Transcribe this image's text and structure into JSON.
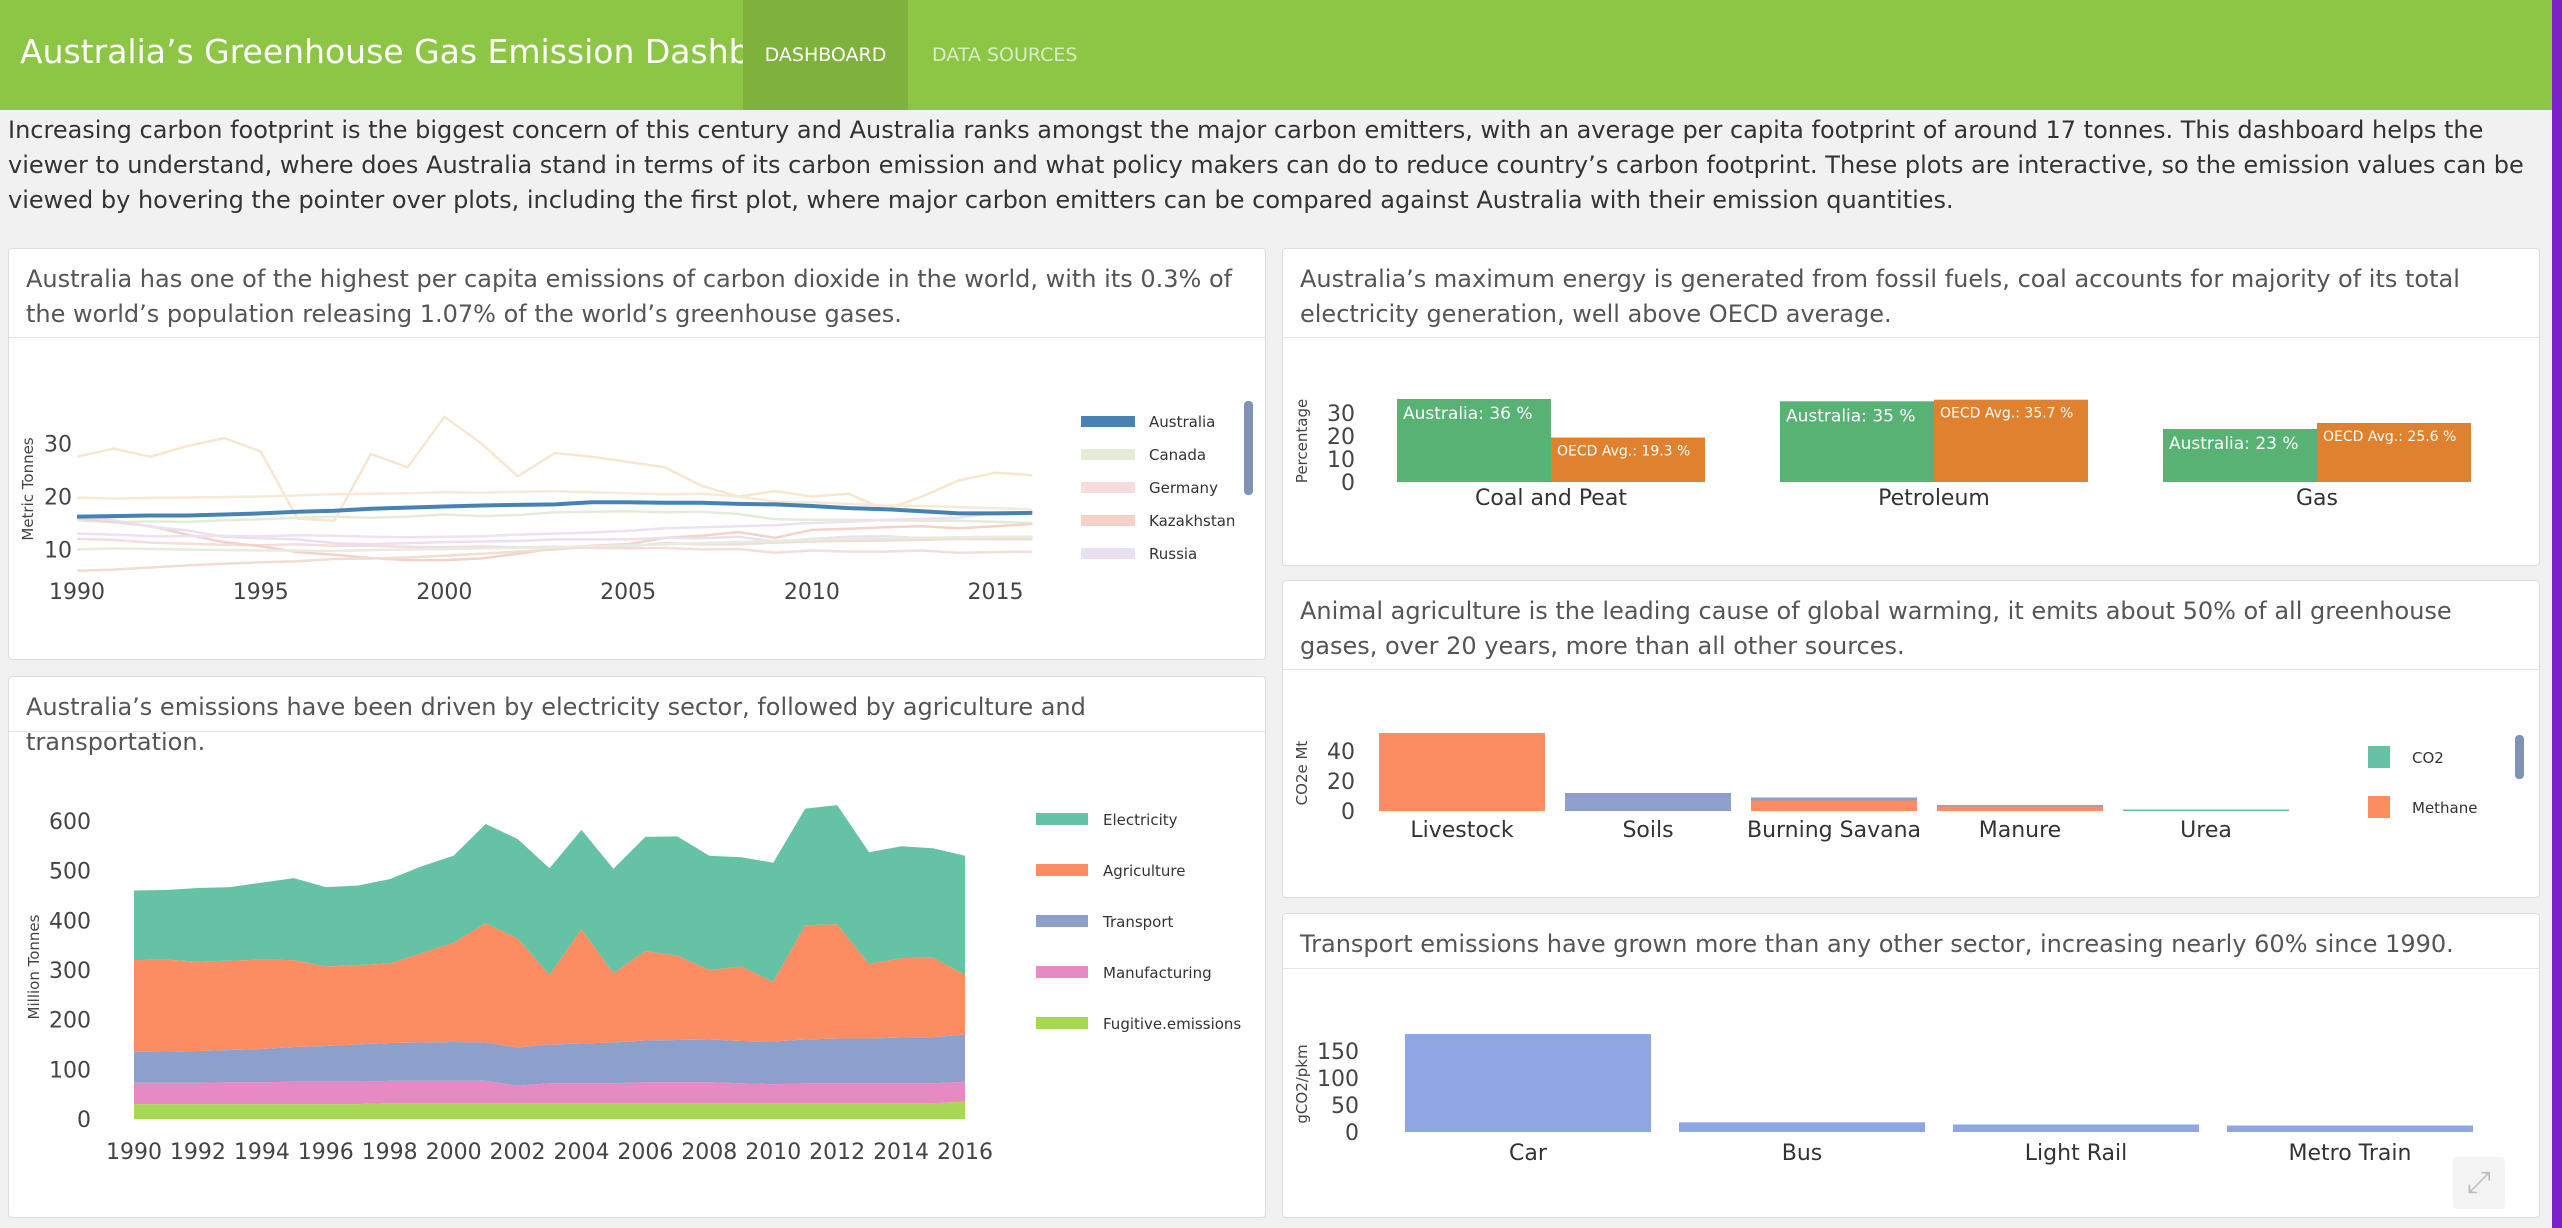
{
  "header": {
    "title": "Australia’s Greenhouse Gas Emission Dashboard",
    "tabs": [
      {
        "label": "DASHBOARD",
        "active": true
      },
      {
        "label": "DATA SOURCES",
        "active": false
      }
    ]
  },
  "intro": "Increasing carbon footprint is the biggest concern of this century and Australia ranks amongst the major carbon emitters, with an average per capita footprint of around 17 tonnes. This dashboard helps the viewer to understand, where does Australia stand in terms of its carbon emission and what policy makers can do to reduce country’s carbon footprint. These plots are interactive, so the emission values can be viewed by hovering the pointer over plots, including the first plot, where major carbon emitters can be compared against Australia with their emission quantities.",
  "panels": {
    "per_capita": {
      "title": "Australia has one of the highest per capita emissions of carbon dioxide in the world, with its 0.3% of the world’s population releasing 1.07% of the world’s greenhouse gases."
    },
    "sectors": {
      "title": "Australia’s emissions have been driven by electricity sector, followed by agriculture and transportation."
    },
    "energy": {
      "title": "Australia’s maximum energy is generated from fossil fuels, coal accounts for majority of its total electricity generation, well above OECD average."
    },
    "agriculture": {
      "title": "Animal agriculture is the leading cause of global warming, it emits about 50% of all greenhouse gases, over 20 years, more than all other sources."
    },
    "transport": {
      "title": "Transport emissions have grown more than any other sector, increasing nearly 60% since 1990."
    }
  },
  "icons": {
    "expand": "expand-arrows-icon"
  },
  "colors": {
    "navbar": "#8dc545",
    "navbar_active": "#7fb23c",
    "australia_line": "#4682b4"
  },
  "chart_data": [
    {
      "type": "line",
      "ylabel": "Metric Tonnes",
      "ylim": [
        5,
        38
      ],
      "yticks": [
        10,
        20,
        30
      ],
      "xticks": [
        1990,
        1995,
        2000,
        2005,
        2010,
        2015
      ],
      "x": [
        1990,
        1991,
        1992,
        1993,
        1994,
        1995,
        1996,
        1997,
        1998,
        1999,
        2000,
        2001,
        2002,
        2003,
        2004,
        2005,
        2006,
        2007,
        2008,
        2009,
        2010,
        2011,
        2012,
        2013,
        2014,
        2015,
        2016
      ],
      "series": [
        {
          "name": "Australia",
          "color": "#4682b4",
          "highlight": true,
          "values": [
            16.2,
            16.3,
            16.4,
            16.4,
            16.6,
            16.8,
            17.1,
            17.3,
            17.7,
            17.9,
            18.1,
            18.3,
            18.4,
            18.5,
            18.9,
            18.9,
            18.8,
            18.8,
            18.6,
            18.5,
            18.2,
            17.8,
            17.6,
            17.2,
            16.8,
            16.8,
            16.9
          ]
        },
        {
          "name": "Canada",
          "color": "#e4ecd9",
          "values": [
            15.5,
            15.1,
            15.3,
            15.2,
            15.5,
            15.7,
            16.0,
            16.2,
            16.0,
            16.2,
            16.6,
            16.3,
            16.5,
            17.0,
            17.1,
            17.2,
            17.0,
            17.1,
            16.7,
            15.7,
            15.6,
            15.6,
            15.5,
            15.4,
            15.4,
            15.2,
            15.0
          ]
        },
        {
          "name": "Germany",
          "color": "#f6dcdc",
          "values": [
            12.0,
            11.8,
            11.3,
            11.1,
            10.9,
            10.8,
            11.0,
            10.7,
            10.7,
            10.5,
            10.4,
            10.6,
            10.4,
            10.5,
            10.3,
            10.2,
            10.3,
            10.0,
            10.1,
            9.4,
            9.8,
            9.6,
            9.6,
            9.8,
            9.4,
            9.5,
            9.6
          ]
        },
        {
          "name": "Kazakhstan",
          "color": "#f5d2c8",
          "values": [
            15.9,
            15.2,
            14.4,
            12.8,
            11.4,
            10.6,
            9.5,
            9.0,
            8.4,
            8.0,
            8.0,
            8.3,
            9.2,
            10.2,
            10.7,
            11.0,
            12.2,
            12.6,
            13.3,
            12.2,
            13.7,
            13.9,
            14.2,
            14.4,
            14.0,
            14.4,
            14.8
          ]
        },
        {
          "name": "Russia",
          "color": "#e9e1ef",
          "values": [
            16.2,
            15.5,
            14.3,
            13.6,
            12.4,
            12.1,
            11.9,
            11.2,
            11.0,
            11.2,
            11.4,
            11.5,
            11.6,
            11.9,
            11.9,
            11.9,
            12.2,
            12.1,
            12.4,
            11.5,
            12.0,
            12.4,
            12.5,
            12.1,
            12.0,
            11.9,
            11.9
          ]
        },
        {
          "name": "",
          "color": "#f8e6cf",
          "values": [
            27.5,
            29.0,
            27.5,
            29.5,
            31.0,
            28.5,
            15.8,
            15.4,
            28.0,
            25.5,
            35.0,
            30.0,
            23.8,
            28.2,
            27.5,
            26.5,
            25.5,
            22.0,
            20.0,
            21.0,
            20.0,
            20.5,
            17.5,
            20.0,
            23.0,
            24.5,
            24.0
          ]
        },
        {
          "name": "",
          "color": "#f7ead4",
          "values": [
            19.8,
            19.6,
            19.7,
            19.8,
            19.9,
            20.0,
            20.2,
            20.4,
            20.5,
            20.6,
            20.8,
            20.7,
            20.9,
            21.0,
            20.8,
            20.6,
            20.4,
            20.5,
            20.0,
            19.0,
            18.9,
            18.6,
            18.3,
            18.2,
            18.0,
            17.8,
            17.6
          ]
        },
        {
          "name": "",
          "color": "#eee1f2",
          "values": [
            13.0,
            12.8,
            12.5,
            12.5,
            12.6,
            12.5,
            12.7,
            12.6,
            12.4,
            12.3,
            12.4,
            12.5,
            12.8,
            13.0,
            13.2,
            13.5,
            14.0,
            14.2,
            14.4,
            14.6,
            15.0,
            15.2,
            15.6,
            15.8,
            16.0,
            17.0,
            17.0
          ]
        },
        {
          "name": "",
          "color": "#f1ddd1",
          "values": [
            6.0,
            6.2,
            6.6,
            7.0,
            7.3,
            7.6,
            7.8,
            8.2,
            8.3,
            8.5,
            8.8,
            9.2,
            9.6,
            10.0,
            10.5,
            10.6,
            11.2,
            11.0,
            11.0,
            11.3,
            11.5,
            11.6,
            11.7,
            11.8,
            12.0,
            12.0,
            12.0
          ]
        },
        {
          "name": "",
          "color": "#e6ecdf",
          "values": [
            10.0,
            10.2,
            10.1,
            10.0,
            9.9,
            9.8,
            9.8,
            9.7,
            9.9,
            10.0,
            10.1,
            10.2,
            10.3,
            10.4,
            10.6,
            10.8,
            11.0,
            11.2,
            11.4,
            11.6,
            11.8,
            12.0,
            12.1,
            12.2,
            12.3,
            12.4,
            12.4
          ]
        }
      ]
    },
    {
      "type": "area",
      "ylabel": "Million Tonnes",
      "ylim": [
        0,
        650
      ],
      "yticks": [
        0,
        100,
        200,
        300,
        400,
        500,
        600
      ],
      "x": [
        1990,
        1991,
        1992,
        1993,
        1994,
        1995,
        1996,
        1997,
        1998,
        1999,
        2000,
        2001,
        2002,
        2003,
        2004,
        2005,
        2006,
        2007,
        2008,
        2009,
        2010,
        2011,
        2012,
        2013,
        2014,
        2015,
        2016
      ],
      "xticks": [
        1990,
        1992,
        1994,
        1996,
        1998,
        2000,
        2002,
        2004,
        2006,
        2008,
        2010,
        2012,
        2014,
        2016
      ],
      "series": [
        {
          "name": "Fugitive.emissions",
          "color": "#a6d854",
          "values": [
            30,
            30,
            30,
            30,
            30,
            30,
            30,
            30,
            32,
            32,
            32,
            32,
            32,
            32,
            32,
            32,
            32,
            32,
            32,
            32,
            32,
            32,
            32,
            32,
            32,
            32,
            35
          ]
        },
        {
          "name": "Manufacturing",
          "color": "#e78ac3",
          "values": [
            43,
            43,
            43,
            44,
            44,
            45,
            45,
            45,
            45,
            45,
            45,
            45,
            35,
            40,
            40,
            40,
            42,
            42,
            42,
            40,
            38,
            40,
            40,
            40,
            40,
            40,
            40
          ]
        },
        {
          "name": "Transport",
          "color": "#8da0cb",
          "values": [
            62,
            63,
            64,
            65,
            67,
            70,
            72,
            75,
            76,
            77,
            78,
            77,
            77,
            78,
            80,
            82,
            84,
            85,
            86,
            85,
            86,
            88,
            90,
            90,
            92,
            93,
            95
          ]
        },
        {
          "name": "Agriculture",
          "color": "#fc8d62",
          "values": [
            185,
            185,
            180,
            180,
            180,
            175,
            160,
            160,
            160,
            180,
            200,
            240,
            220,
            140,
            230,
            140,
            180,
            170,
            140,
            150,
            120,
            230,
            230,
            150,
            160,
            160,
            120
          ]
        },
        {
          "name": "Electricity",
          "color": "#66c2a5",
          "values": [
            140,
            140,
            148,
            148,
            155,
            165,
            160,
            160,
            170,
            175,
            175,
            200,
            200,
            215,
            200,
            210,
            230,
            240,
            230,
            220,
            240,
            235,
            240,
            225,
            225,
            220,
            240
          ]
        }
      ],
      "legend_order": [
        "Electricity",
        "Agriculture",
        "Transport",
        "Manufacturing",
        "Fugitive.emissions"
      ]
    },
    {
      "type": "bar",
      "ylabel": "Percentage",
      "ylim": [
        0,
        36
      ],
      "yticks": [
        0,
        10,
        20,
        30
      ],
      "categories": [
        "Coal and Peat",
        "Petroleum",
        "Gas"
      ],
      "series": [
        {
          "name": "Australia",
          "color": "#57b274",
          "values": [
            36,
            35,
            23
          ]
        },
        {
          "name": "OECD Avg.",
          "color": "#e0812f",
          "values": [
            19.3,
            35.7,
            25.6
          ]
        }
      ],
      "data_labels": [
        [
          "Australia:  36 %",
          "Australia:  35 %",
          "Australia:  23 %"
        ],
        [
          "OECD Avg.: 19.3 %",
          "OECD Avg.: 35.7 %",
          "OECD Avg.: 25.6 %"
        ]
      ]
    },
    {
      "type": "bar",
      "ylabel": "CO2e Mt",
      "ylim": [
        0,
        55
      ],
      "yticks": [
        0,
        20,
        40
      ],
      "categories": [
        "Livestock",
        "Soils",
        "Burning Savana",
        "Manure",
        "Urea"
      ],
      "series": [
        {
          "name": "Methane",
          "color": "#fc8d62",
          "values": [
            52,
            0,
            7,
            3,
            0
          ]
        },
        {
          "name": "CO2",
          "color": "#66c2a5",
          "values": [
            0,
            0,
            0,
            0,
            1
          ]
        },
        {
          "name": "",
          "color": "#8da0cb",
          "values": [
            0,
            12,
            2,
            1,
            0
          ]
        }
      ],
      "legend": [
        "CO2",
        "Methane"
      ]
    },
    {
      "type": "bar",
      "ylabel": "gCO2/pkm",
      "ylim": [
        0,
        190
      ],
      "yticks": [
        0,
        50,
        100,
        150
      ],
      "categories": [
        "Car",
        "Bus",
        "Light Rail",
        "Metro Train"
      ],
      "values": [
        182,
        18,
        14,
        12
      ],
      "color": "#8ea6e2"
    }
  ]
}
